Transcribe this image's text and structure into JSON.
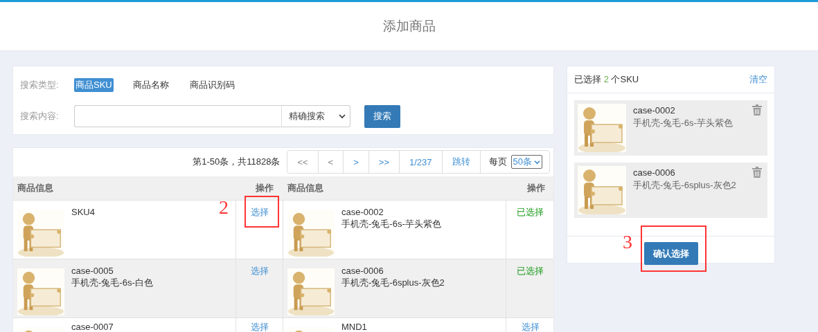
{
  "page": {
    "title": "添加商品"
  },
  "search": {
    "type_label": "搜索类型:",
    "types": [
      {
        "label": "商品SKU",
        "selected": true
      },
      {
        "label": "商品名称",
        "selected": false
      },
      {
        "label": "商品识别码",
        "selected": false
      }
    ],
    "content_label": "搜索内容:",
    "mode": "精确搜索",
    "button": "搜索"
  },
  "table": {
    "summary": "第1-50条，共11828条",
    "pager": [
      {
        "label": "<<",
        "disabled": true
      },
      {
        "label": "<",
        "disabled": true
      },
      {
        "label": ">",
        "disabled": false
      },
      {
        "label": ">>",
        "disabled": false
      },
      {
        "label": "1/237",
        "disabled": false
      },
      {
        "label": "跳转",
        "disabled": false
      }
    ],
    "per_page_label": "每页",
    "per_page": "50条",
    "columns": [
      {
        "info": "商品信息",
        "action": "操作"
      },
      {
        "info": "商品信息",
        "action": "操作"
      }
    ],
    "rows": [
      [
        {
          "code": "SKU4",
          "action": "选择",
          "selected": false
        },
        {
          "code": "case-0002",
          "name": "手机壳-兔毛-6s-芋头紫色",
          "action": "已选择",
          "selected": true
        }
      ],
      [
        {
          "code": "case-0005",
          "name": "手机壳-兔毛-6s-白色",
          "action": "选择",
          "selected": false
        },
        {
          "code": "case-0006",
          "name": "手机壳-兔毛-6splus-灰色2",
          "action": "已选择",
          "selected": true
        }
      ],
      [
        {
          "code": "case-0007",
          "action": "选择",
          "selected": false
        },
        {
          "code": "MND1",
          "action": "选择",
          "selected": false
        }
      ]
    ]
  },
  "selection": {
    "prefix": "已选择",
    "count": "2",
    "suffix": "个SKU",
    "clear": "清空",
    "items": [
      {
        "code": "case-0002",
        "name": "手机壳-兔毛-6s-芋头紫色"
      },
      {
        "code": "case-0006",
        "name": "手机壳-兔毛-6splus-灰色2"
      }
    ],
    "confirm": "确认选择"
  },
  "annotations": [
    {
      "label": "2"
    },
    {
      "label": "3"
    }
  ]
}
